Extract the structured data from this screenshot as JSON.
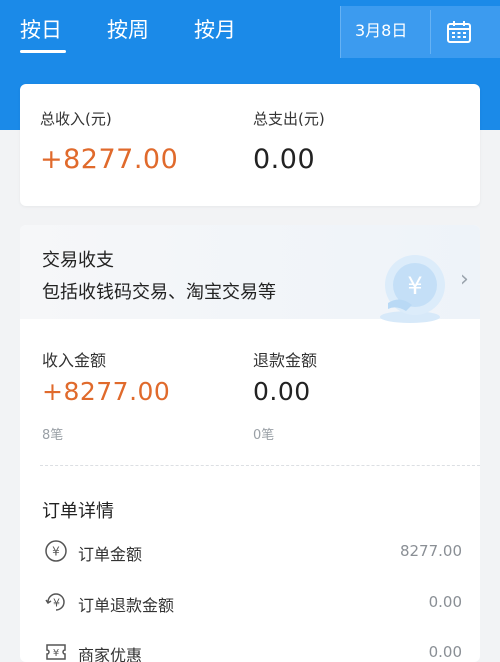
{
  "tabs": [
    {
      "label": "按日",
      "active": true
    },
    {
      "label": "按周",
      "active": false
    },
    {
      "label": "按月",
      "active": false
    }
  ],
  "date_label": "3月8日",
  "summary": {
    "income_label": "总收入(元)",
    "income_value": "+8277.00",
    "expense_label": "总支出(元)",
    "expense_value": "0.00"
  },
  "transaction": {
    "title": "交易收支",
    "subtitle": "包括收钱码交易、淘宝交易等",
    "income_label": "收入金额",
    "income_value": "+8277.00",
    "income_count": "8笔",
    "refund_label": "退款金额",
    "refund_value": "0.00",
    "refund_count": "0笔"
  },
  "order": {
    "title": "订单详情",
    "rows": [
      {
        "icon": "yen-circle-icon",
        "label": "订单金额",
        "value": "8277.00"
      },
      {
        "icon": "yen-refund-icon",
        "label": "订单退款金额",
        "value": "0.00"
      },
      {
        "icon": "merchant-discount-icon",
        "label": "商家优惠",
        "value": "0.00"
      }
    ]
  },
  "colors": {
    "header_blue": "#1b8ae8",
    "income_orange": "#e06a2c"
  }
}
